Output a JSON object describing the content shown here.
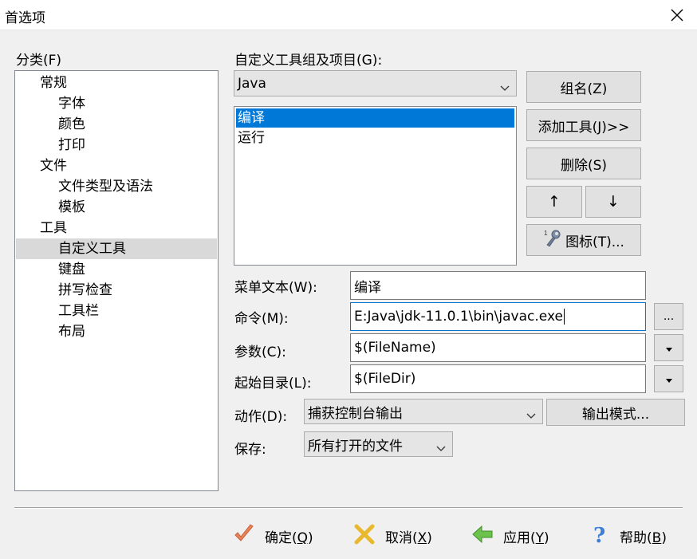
{
  "window": {
    "title": "首选项",
    "close_icon": "close-icon"
  },
  "categories": {
    "label": "分类(F)",
    "items": [
      {
        "label": "常规",
        "level": 0,
        "selected": false
      },
      {
        "label": "字体",
        "level": 1,
        "selected": false
      },
      {
        "label": "颜色",
        "level": 1,
        "selected": false
      },
      {
        "label": "打印",
        "level": 1,
        "selected": false
      },
      {
        "label": "文件",
        "level": 0,
        "selected": false
      },
      {
        "label": "文件类型及语法",
        "level": 1,
        "selected": false
      },
      {
        "label": "模板",
        "level": 1,
        "selected": false
      },
      {
        "label": "工具",
        "level": 0,
        "selected": false
      },
      {
        "label": "自定义工具",
        "level": 1,
        "selected": true
      },
      {
        "label": "键盘",
        "level": 1,
        "selected": false
      },
      {
        "label": "拼写检查",
        "level": 1,
        "selected": false
      },
      {
        "label": "工具栏",
        "level": 1,
        "selected": false
      },
      {
        "label": "布局",
        "level": 1,
        "selected": false
      }
    ]
  },
  "tools": {
    "group_label": "自定义工具组及项目(G):",
    "group_selected": "Java",
    "items": [
      {
        "label": "编译",
        "selected": true
      },
      {
        "label": "运行",
        "selected": false
      }
    ],
    "buttons": {
      "group_name": "组名(Z)",
      "add_tool": "添加工具(J)>>",
      "delete": "删除(S)",
      "up": "↑",
      "down": "↓",
      "icon": "图标(T)..."
    }
  },
  "form": {
    "menu_text_label": "菜单文本(W):",
    "menu_text_value": "编译",
    "command_label": "命令(M):",
    "command_value": "E:Java\\jdk-11.0.1\\bin\\javac.exe",
    "browse_label": "...",
    "args_label": "参数(C):",
    "args_value": "$(FileName)",
    "startdir_label": "起始目录(L):",
    "startdir_value": "$(FileDir)",
    "action_label": "动作(D):",
    "action_value": "捕获控制台输出",
    "output_mode": "输出模式...",
    "save_label": "保存:",
    "save_value": "所有打开的文件"
  },
  "footer": {
    "ok": {
      "text": "确定",
      "key": "Q"
    },
    "cancel": {
      "text": "取消",
      "key": "X"
    },
    "apply": {
      "text": "应用",
      "key": "Y"
    },
    "help": {
      "text": "帮助",
      "key": "B"
    }
  },
  "colors": {
    "selection": "#0078d7",
    "tree_selection": "#d9d9d9",
    "background": "#f0f0f0"
  }
}
